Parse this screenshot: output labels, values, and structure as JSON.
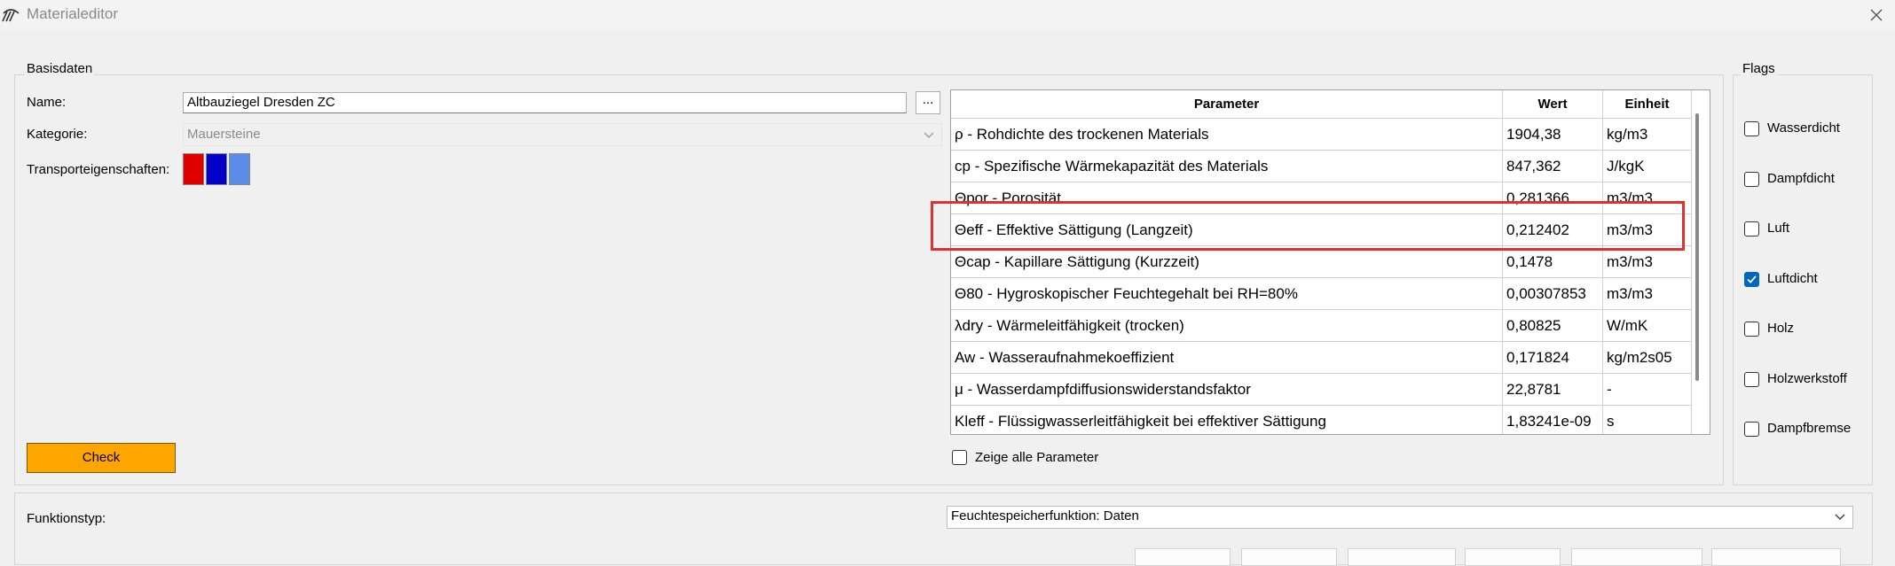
{
  "window": {
    "title": "Materialeditor"
  },
  "basisdaten": {
    "group_label": "Basisdaten",
    "name_label": "Name:",
    "name_value": "Altbauziegel Dresden ZC",
    "dots_button": "...",
    "kategorie_label": "Kategorie:",
    "kategorie_value": "Mauersteine",
    "transport_label": "Transporteigenschaften:",
    "swatches": [
      "#e00000",
      "#0000c8",
      "#5a8ce8"
    ],
    "check_button": "Check"
  },
  "table": {
    "headers": [
      "Parameter",
      "Wert",
      "Einheit"
    ],
    "rows": [
      [
        "ρ - Rohdichte des trockenen Materials",
        "1904,38",
        "kg/m3"
      ],
      [
        "cp - Spezifische Wärmekapazität des Materials",
        "847,362",
        "J/kgK"
      ],
      [
        "Θpor - Porosität",
        "0,281366",
        "m3/m3"
      ],
      [
        "Θeff - Effektive Sättigung (Langzeit)",
        "0,212402",
        "m3/m3"
      ],
      [
        "Θcap - Kapillare Sättigung (Kurzzeit)",
        "0,1478",
        "m3/m3"
      ],
      [
        "Θ80 - Hygroskopischer Feuchtegehalt bei RH=80%",
        "0,00307853",
        "m3/m3"
      ],
      [
        "λdry - Wärmeleitfähigkeit (trocken)",
        "0,80825",
        "W/mK"
      ],
      [
        "Aw - Wasseraufnahmekoeffizient",
        "0,171824",
        "kg/m2s05"
      ],
      [
        "μ - Wasserdampfdiffusionswiderstandsfaktor",
        "22,8781",
        "-"
      ],
      [
        "Kleff - Flüssigwasserleitfähigkeit bei effektiver Sättigung",
        "1,83241e-09",
        "s"
      ]
    ],
    "highlight_color": "#e03030"
  },
  "show_all": {
    "label": "Zeige alle Parameter",
    "checked": false
  },
  "flags": {
    "group_label": "Flags",
    "items": [
      {
        "label": "Wasserdicht",
        "checked": false
      },
      {
        "label": "Dampfdicht",
        "checked": false
      },
      {
        "label": "Luft",
        "checked": false
      },
      {
        "label": "Luftdicht",
        "checked": true
      },
      {
        "label": "Holz",
        "checked": false
      },
      {
        "label": "Holzwerkstoff",
        "checked": false
      },
      {
        "label": "Dampfbremse",
        "checked": false
      }
    ]
  },
  "function": {
    "label": "Funktionstyp:",
    "value": "Feuchtespeicherfunktion: Daten"
  },
  "colors": {
    "check_button": "#ffa500",
    "accent": "#0067c0"
  }
}
